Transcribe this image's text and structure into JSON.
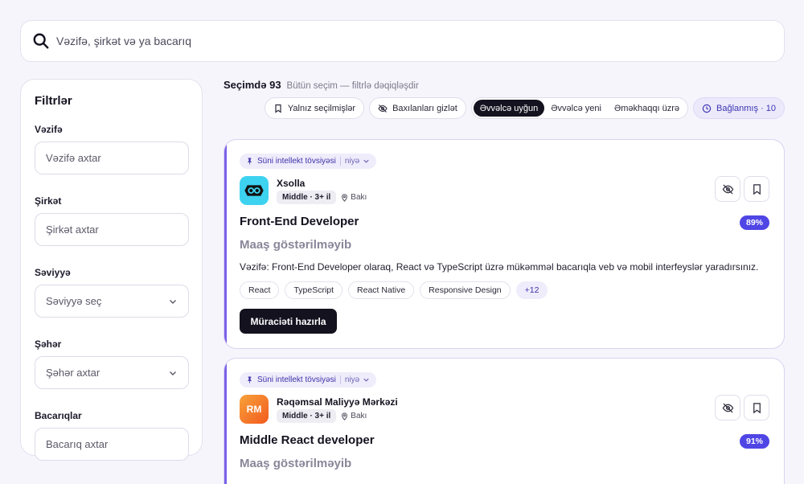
{
  "search": {
    "placeholder": "Vəzifə, şirkət və ya bacarıq"
  },
  "filters": {
    "title": "Filtrlər",
    "fields": [
      {
        "label": "Vəzifə",
        "placeholder": "Vəzifə axtar"
      },
      {
        "label": "Şirkət",
        "placeholder": "Şirkət axtar"
      },
      {
        "label": "Səviyyə",
        "placeholder": "Səviyyə seç"
      },
      {
        "label": "Şəhər",
        "placeholder": "Şəhər axtar"
      },
      {
        "label": "Bacarıqlar",
        "placeholder": "Bacarıq axtar"
      }
    ]
  },
  "results": {
    "count": "Seçimdə 93",
    "hint": "Bütün seçim — filtrlə dəqiqləşdir"
  },
  "toolbar": {
    "only_selected": "Yalnız seçilmişlər",
    "hide_viewed": "Baxılanları gizlət",
    "sort_options": [
      "Əvvəlcə uyğun",
      "Əvvəlcə yeni",
      "Əməkhaqqı üzrə"
    ],
    "sort_active": "Əvvəlcə uyğun",
    "linked": "Bağlanmış · 10"
  },
  "jobs": [
    {
      "ai_label": "Süni intellekt tövsiyəsi",
      "why": "niyə",
      "company": "Xsolla",
      "level": "Middle · 3+ il",
      "location": "Bakı",
      "title": "Front-End Developer",
      "match": "89%",
      "salary": "Maaş göstərilməyib",
      "description": "Vəzifə: Front-End Developer olaraq, React və TypeScript üzrə mükəmməl bacarıqla veb və mobil interfeyslər yaradırsınız.",
      "skills": [
        "React",
        "TypeScript",
        "React Native",
        "Responsive Design",
        "+12"
      ],
      "apply": "Müraciəti hazırla"
    },
    {
      "ai_label": "Süni intellekt tövsiyəsi",
      "why": "niyə",
      "company": "Rəqəmsal Maliyyə Mərkəzi",
      "logo_text": "RM",
      "level": "Middle · 3+ il",
      "location": "Bakı",
      "title": "Middle React developer",
      "match": "91%",
      "salary": "Maaş göstərilməyib"
    }
  ],
  "colors": {
    "accent": "#4f46e5",
    "dark": "#14121f",
    "ai_bg": "#efecfb"
  }
}
